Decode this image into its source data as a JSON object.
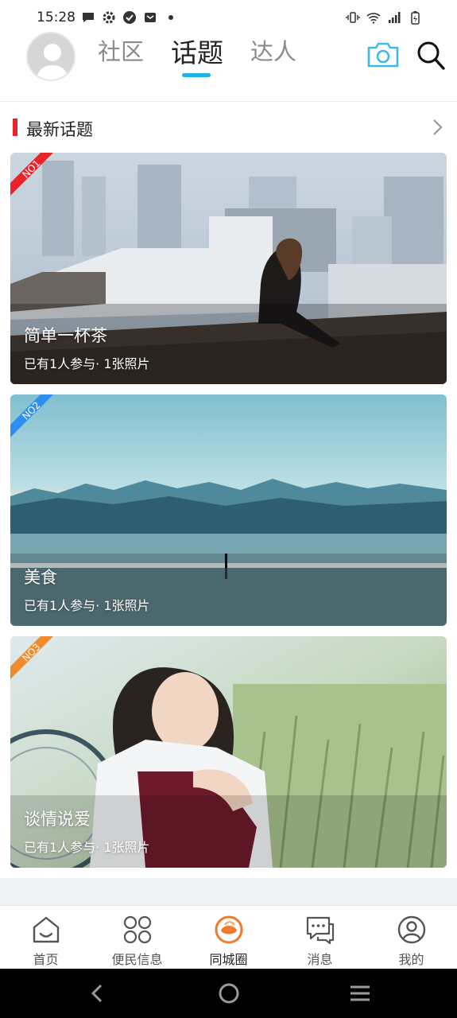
{
  "status_bar": {
    "time": "15:28",
    "left_icons": [
      "message-icon",
      "settings-icon",
      "check-icon",
      "mail-icon",
      "dot-icon"
    ],
    "right_icons": [
      "vibrate-icon",
      "wifi-icon",
      "signal-icon",
      "battery-icon"
    ]
  },
  "header": {
    "tabs": [
      {
        "label": "社区",
        "active": false
      },
      {
        "label": "话题",
        "active": true
      },
      {
        "label": "达人",
        "active": false
      }
    ],
    "accent_color": "#1eb0e6"
  },
  "section": {
    "title": "最新话题",
    "accent_color": "#e8232b"
  },
  "topics": [
    {
      "rank": "NO1",
      "badge_color": "#e8232b",
      "title": "简单一杯茶",
      "meta": "已有1人参与· 1张照片"
    },
    {
      "rank": "NO2",
      "badge_color": "#2f8ef0",
      "title": "美食",
      "meta": "已有1人参与· 1张照片"
    },
    {
      "rank": "NO3",
      "badge_color": "#f08a2a",
      "title": "谈情说爱",
      "meta": "已有1人参与· 1张照片"
    }
  ],
  "bottom_nav": [
    {
      "label": "首页",
      "icon": "home-icon",
      "active": false
    },
    {
      "label": "便民信息",
      "icon": "grid-icon",
      "active": false
    },
    {
      "label": "同城圈",
      "icon": "circle-chat-icon",
      "active": true
    },
    {
      "label": "消息",
      "icon": "message-bubble-icon",
      "active": false
    },
    {
      "label": "我的",
      "icon": "profile-icon",
      "active": false
    }
  ],
  "system_nav": [
    "back-icon",
    "home-circle-icon",
    "menu-icon"
  ]
}
